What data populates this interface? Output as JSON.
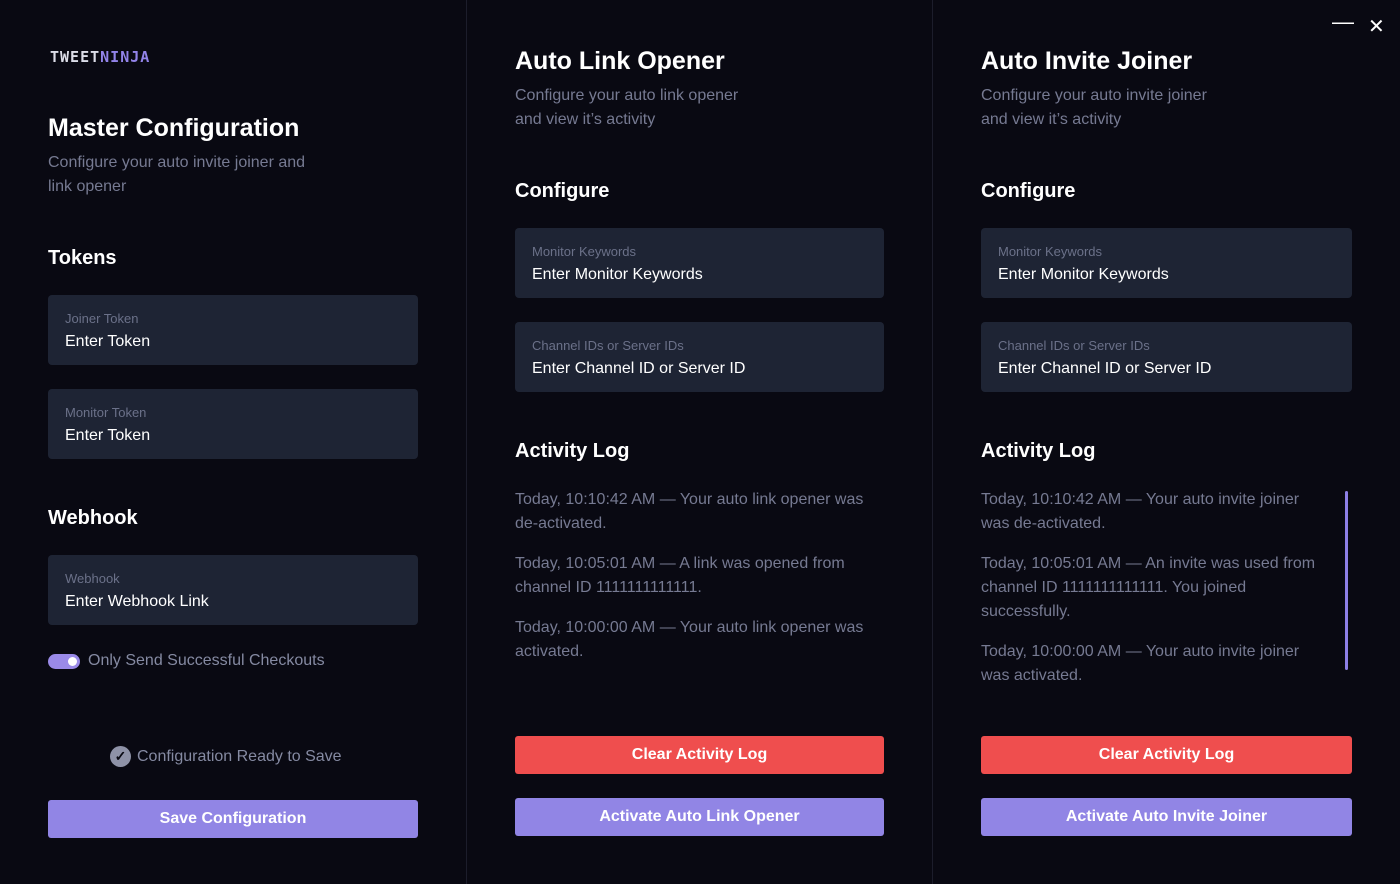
{
  "window": {
    "minimize_glyph": "—",
    "close_glyph": "✕"
  },
  "logo": {
    "part1": "TWEET",
    "part2": "NINJA"
  },
  "master": {
    "title": "Master Configuration",
    "subtitle": "Configure your auto invite joiner and link opener",
    "tokens_heading": "Tokens",
    "joiner_token": {
      "label": "Joiner Token",
      "placeholder": "Enter Token"
    },
    "monitor_token": {
      "label": "Monitor Token",
      "placeholder": "Enter Token"
    },
    "webhook_heading": "Webhook",
    "webhook": {
      "label": "Webhook",
      "placeholder": "Enter Webhook Link"
    },
    "toggle_label": "Only Send Successful Checkouts",
    "toggle_on": true,
    "ready_text": "Configuration Ready to Save",
    "save_button": "Save Configuration"
  },
  "link_opener": {
    "title": "Auto Link Opener",
    "subtitle": "Configure your auto link opener and view it’s activity",
    "configure_heading": "Configure",
    "keywords": {
      "label": "Monitor Keywords",
      "placeholder": "Enter Monitor Keywords"
    },
    "channels": {
      "label": "Channel IDs or Server IDs",
      "placeholder": "Enter Channel ID or Server ID"
    },
    "log_heading": "Activity Log",
    "log": [
      "Today, 10:10:42 AM — Your auto link opener was de-activated.",
      "Today, 10:05:01 AM — A link was opened from channel ID 1111111111111.",
      "Today, 10:00:00 AM — Your auto link opener was activated."
    ],
    "clear_button": "Clear Activity Log",
    "activate_button": "Activate Auto Link Opener"
  },
  "invite_joiner": {
    "title": "Auto Invite Joiner",
    "subtitle": "Configure your auto invite joiner and view it’s activity",
    "configure_heading": "Configure",
    "keywords": {
      "label": "Monitor Keywords",
      "placeholder": "Enter Monitor Keywords"
    },
    "channels": {
      "label": "Channel IDs or Server IDs",
      "placeholder": "Enter Channel ID or Server ID"
    },
    "log_heading": "Activity Log",
    "log": [
      "Today, 10:10:42 AM — Your auto invite joiner was de-activated.",
      "Today, 10:05:01 AM — An invite was used from channel ID 1111111111111. You joined successfully.",
      "Today, 10:00:00 AM — Your auto invite joiner was activated."
    ],
    "clear_button": "Clear Activity Log",
    "activate_button": "Activate Auto Invite Joiner"
  },
  "colors": {
    "background": "#090912",
    "field": "#1e2434",
    "accent": "#9185e5",
    "danger": "#ef4e4e"
  }
}
